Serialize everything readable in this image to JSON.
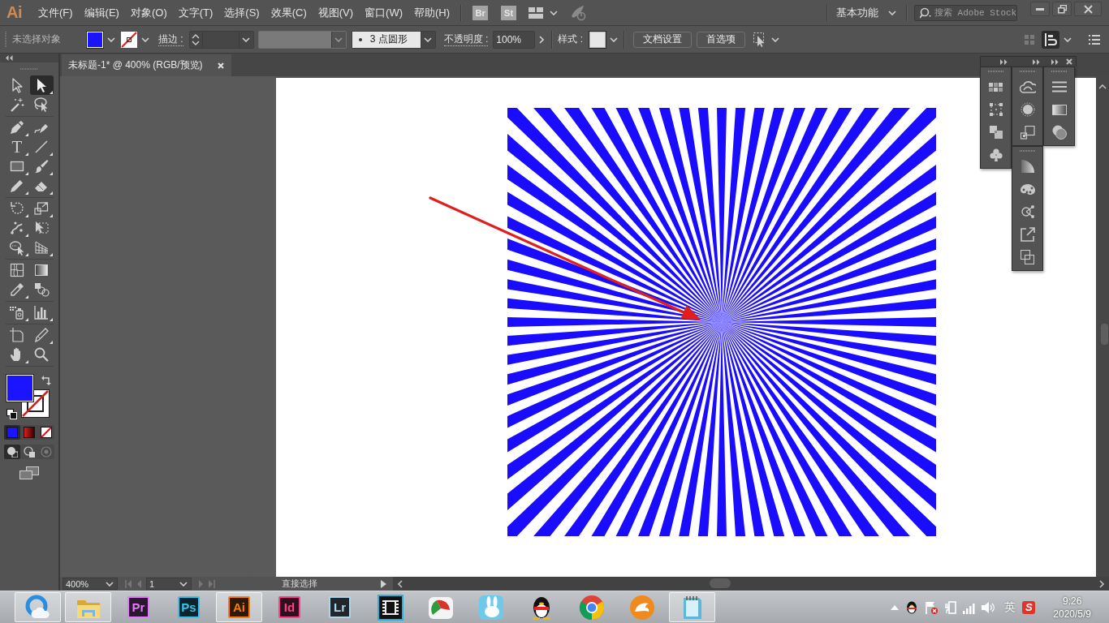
{
  "app": {
    "logo": "Ai"
  },
  "menu": [
    "文件(F)",
    "编辑(E)",
    "对象(O)",
    "文字(T)",
    "选择(S)",
    "效果(C)",
    "视图(V)",
    "窗口(W)",
    "帮助(H)"
  ],
  "bridge_buttons": [
    {
      "label": "Br"
    },
    {
      "label": "St"
    }
  ],
  "workspace": {
    "label": "基本功能"
  },
  "search": {
    "placeholder": "搜索 Adobe Stock"
  },
  "control_bar": {
    "selection_status": "未选择对象",
    "stroke_label": "描边 :",
    "brush": "3 点圆形",
    "opacity_label": "不透明度 :",
    "opacity": "100%",
    "style_label": "样式 :",
    "buttons": [
      {
        "label": "文档设置"
      },
      {
        "label": "首选项"
      }
    ]
  },
  "tool_groups": [
    {
      "tools": [
        {
          "kind": "selection",
          "selected": false,
          "flyout": false
        },
        {
          "kind": "direct-selection",
          "selected": true,
          "flyout": true
        },
        {
          "kind": "magic-wand",
          "selected": false,
          "flyout": false
        },
        {
          "kind": "lasso",
          "selected": false,
          "flyout": false
        }
      ]
    },
    {
      "tools": [
        {
          "kind": "pen",
          "selected": false,
          "flyout": true
        },
        {
          "kind": "curvature",
          "selected": false,
          "flyout": false
        },
        {
          "kind": "type",
          "glyph": "T",
          "selected": false,
          "flyout": true
        },
        {
          "kind": "line",
          "selected": false,
          "flyout": true
        },
        {
          "kind": "rectangle",
          "selected": false,
          "flyout": true
        },
        {
          "kind": "paintbrush",
          "selected": false,
          "flyout": true
        },
        {
          "kind": "pencil",
          "selected": false,
          "flyout": true
        },
        {
          "kind": "eraser",
          "selected": false,
          "flyout": true
        }
      ]
    },
    {
      "tools": [
        {
          "kind": "rotate",
          "selected": false,
          "flyout": true
        },
        {
          "kind": "scale",
          "selected": false,
          "flyout": true
        },
        {
          "kind": "warp",
          "selected": false,
          "flyout": true
        },
        {
          "kind": "free-transform",
          "selected": false,
          "flyout": false
        },
        {
          "kind": "shape-builder",
          "selected": false,
          "flyout": true
        },
        {
          "kind": "perspective-grid",
          "selected": false,
          "flyout": true
        }
      ]
    },
    {
      "tools": [
        {
          "kind": "mesh",
          "selected": false,
          "flyout": false
        },
        {
          "kind": "gradient",
          "selected": false,
          "flyout": false
        },
        {
          "kind": "eyedropper",
          "selected": false,
          "flyout": true
        },
        {
          "kind": "blend",
          "selected": false,
          "flyout": false
        }
      ]
    },
    {
      "tools": [
        {
          "kind": "symbol-sprayer",
          "selected": false,
          "flyout": true
        },
        {
          "kind": "column-graph",
          "selected": false,
          "flyout": true
        }
      ]
    },
    {
      "tools": [
        {
          "kind": "artboard",
          "selected": false,
          "flyout": false
        },
        {
          "kind": "slice",
          "selected": false,
          "flyout": true
        },
        {
          "kind": "hand",
          "selected": false,
          "flyout": true
        },
        {
          "kind": "zoom",
          "selected": false,
          "flyout": false
        }
      ]
    }
  ],
  "color_modes": [
    {
      "kind": "color",
      "selected": true
    },
    {
      "kind": "gradient",
      "selected": false
    },
    {
      "kind": "none",
      "selected": false
    }
  ],
  "draw_modes": [
    {
      "kind": "normal",
      "selected": true,
      "disabled": false
    },
    {
      "kind": "behind",
      "selected": false,
      "disabled": false
    },
    {
      "kind": "inside",
      "selected": false,
      "disabled": true
    }
  ],
  "document_tab": {
    "title": "未标题-1* @ 400% (RGB/预览)"
  },
  "status_bar": {
    "zoom": "400%",
    "artboard": "1",
    "current_tool": "直接选择"
  },
  "taskbar": {
    "apps": [
      {
        "kind": "cloud-orb",
        "active": true
      },
      {
        "kind": "folder",
        "active": true
      },
      {
        "kind": "app-tile",
        "label": "Pr",
        "color": "#ea77ff",
        "active": false
      },
      {
        "kind": "app-tile",
        "label": "Ps",
        "color": "#31c5f0",
        "active": false
      },
      {
        "kind": "app-tile",
        "label": "Ai",
        "color": "#ff7c00",
        "active": true
      },
      {
        "kind": "app-tile",
        "label": "Id",
        "color": "#ff3f8b",
        "active": false
      },
      {
        "kind": "app-tile",
        "label": "Lr",
        "color": "#add5ec",
        "active": false
      },
      {
        "kind": "film",
        "active": false
      },
      {
        "kind": "pie-app",
        "active": false
      },
      {
        "kind": "rabbit",
        "active": false
      },
      {
        "kind": "penguin",
        "active": false
      },
      {
        "kind": "wheel",
        "active": false
      },
      {
        "kind": "animal-disc",
        "active": false
      },
      {
        "kind": "notepad",
        "active": true
      }
    ]
  },
  "tray": {
    "input_language": "英",
    "ime_badge": "S",
    "time": "9:26",
    "date": "2020/5/9"
  }
}
